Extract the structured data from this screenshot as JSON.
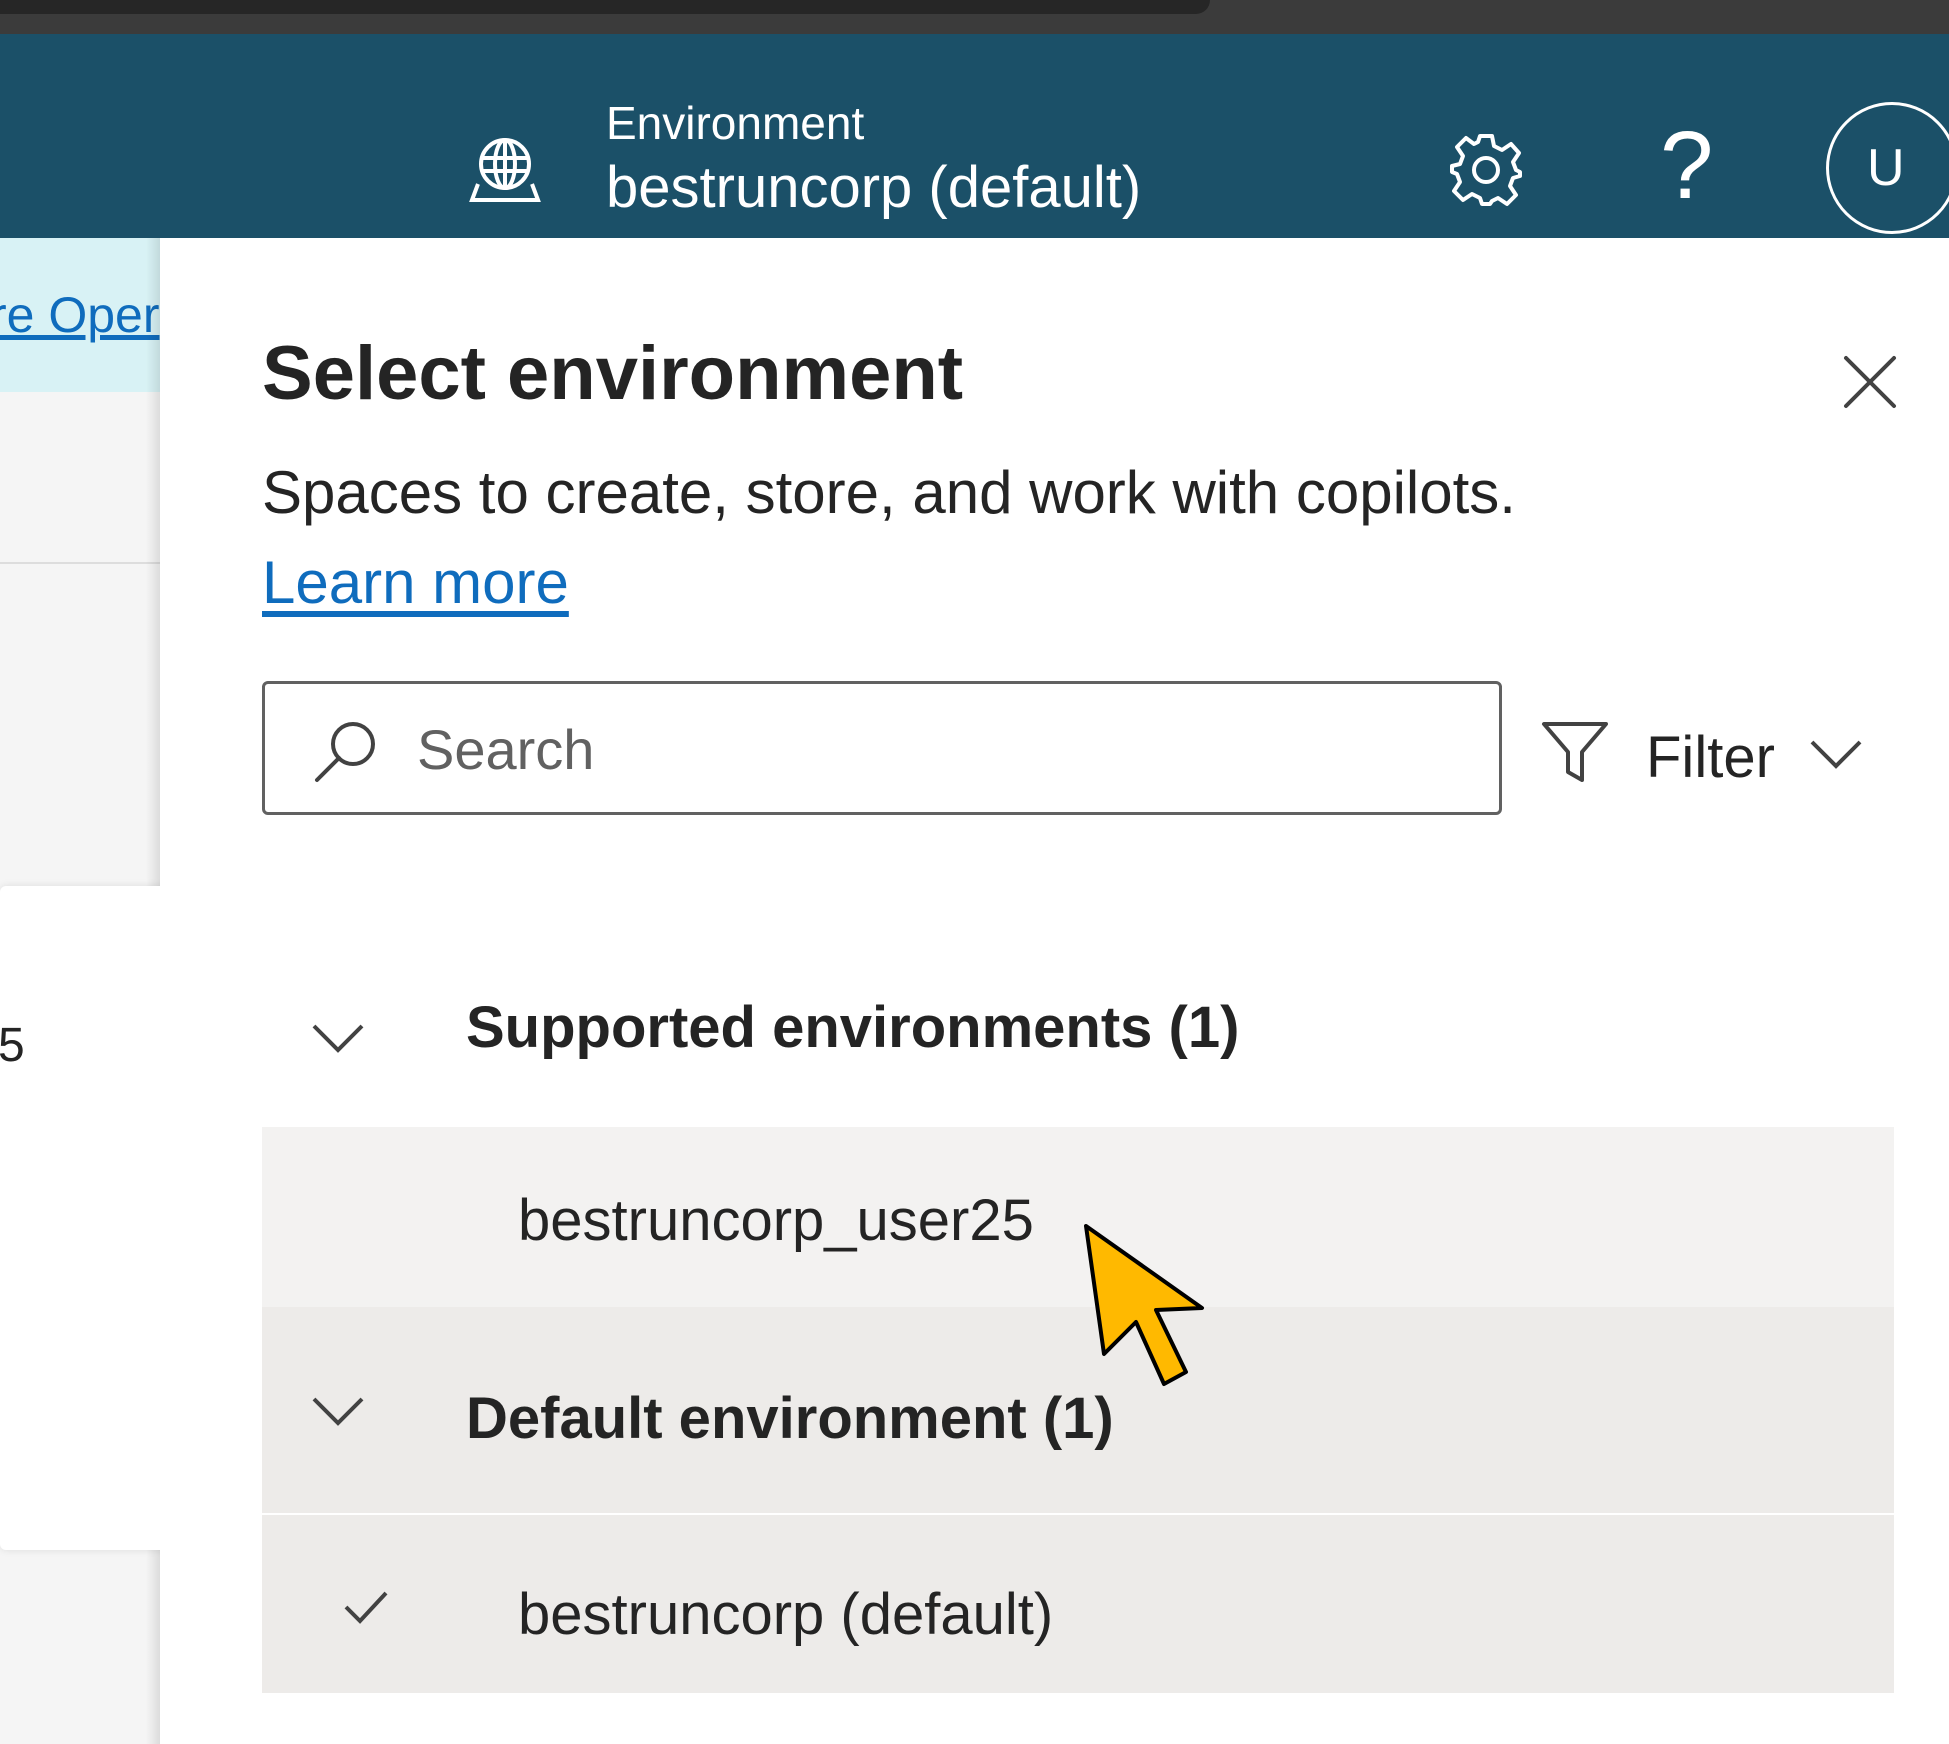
{
  "header": {
    "environment_label": "Environment",
    "environment_value": "bestruncorp (default)",
    "help_glyph": "?",
    "avatar_initial": "U"
  },
  "background": {
    "banner_link": "re Oper",
    "card_number": "5"
  },
  "panel": {
    "title": "Select environment",
    "description": "Spaces to create, store, and work with copilots.",
    "learn_more": "Learn more",
    "search": {
      "placeholder": "Search",
      "value": ""
    },
    "filter_label": "Filter",
    "groups": [
      {
        "label": "Supported environments (1)",
        "items": [
          {
            "label": "bestruncorp_user25",
            "selected": false,
            "hovered": true
          }
        ]
      },
      {
        "label": "Default environment (1)",
        "items": [
          {
            "label": "bestruncorp (default)",
            "selected": true
          }
        ]
      }
    ]
  },
  "colors": {
    "header_bg": "#1b5068",
    "link": "#0f6cbd",
    "hover_row": "#f3f2f1",
    "selected_row": "#edebe9",
    "cursor": "#ffb900"
  }
}
